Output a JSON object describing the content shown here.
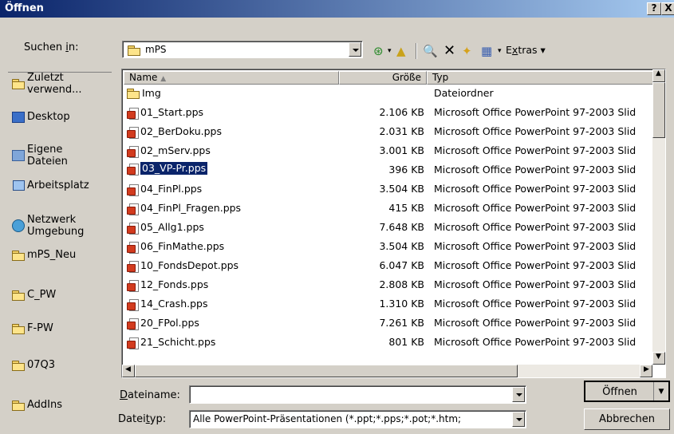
{
  "window": {
    "title": "Öffnen",
    "help": "?",
    "close": "X"
  },
  "lookin": {
    "label": "Suchen in:",
    "value": "mPS"
  },
  "toolbar": {
    "extras": "Extras"
  },
  "places": [
    {
      "label": "Zuletzt verwend...",
      "icon": "recent-folder-icon"
    },
    {
      "label": "Desktop",
      "icon": "desktop-icon"
    },
    {
      "label": "Eigene Dateien",
      "icon": "my-documents-icon"
    },
    {
      "label": "Arbeitsplatz",
      "icon": "my-computer-icon"
    },
    {
      "label": "Netzwerk Umgebung",
      "icon": "network-icon"
    },
    {
      "label": "mPS_Neu",
      "icon": "folder-icon"
    },
    {
      "label": "C_PW",
      "icon": "folder-icon"
    },
    {
      "label": "F-PW",
      "icon": "folder-icon"
    },
    {
      "label": "07Q3",
      "icon": "folder-icon"
    },
    {
      "label": "AddIns",
      "icon": "folder-icon"
    }
  ],
  "columns": {
    "name": "Name",
    "size": "Größe",
    "type": "Typ"
  },
  "files": [
    {
      "name": "Img",
      "size": "",
      "type": "Dateiordner",
      "folder": true
    },
    {
      "name": "01_Start.pps",
      "size": "2.106 KB",
      "type": "Microsoft Office PowerPoint 97-2003 Slid"
    },
    {
      "name": "02_BerDoku.pps",
      "size": "2.031 KB",
      "type": "Microsoft Office PowerPoint 97-2003 Slid"
    },
    {
      "name": "02_mServ.pps",
      "size": "3.001 KB",
      "type": "Microsoft Office PowerPoint 97-2003 Slid"
    },
    {
      "name": "03_VP-Pr.pps",
      "size": "396 KB",
      "type": "Microsoft Office PowerPoint 97-2003 Slid",
      "selected": true
    },
    {
      "name": "04_FinPl.pps",
      "size": "3.504 KB",
      "type": "Microsoft Office PowerPoint 97-2003 Slid"
    },
    {
      "name": "04_FinPl_Fragen.pps",
      "size": "415 KB",
      "type": "Microsoft Office PowerPoint 97-2003 Slid"
    },
    {
      "name": "05_Allg1.pps",
      "size": "7.648 KB",
      "type": "Microsoft Office PowerPoint 97-2003 Slid"
    },
    {
      "name": "06_FinMathe.pps",
      "size": "3.504 KB",
      "type": "Microsoft Office PowerPoint 97-2003 Slid"
    },
    {
      "name": "10_FondsDepot.pps",
      "size": "6.047 KB",
      "type": "Microsoft Office PowerPoint 97-2003 Slid"
    },
    {
      "name": "12_Fonds.pps",
      "size": "2.808 KB",
      "type": "Microsoft Office PowerPoint 97-2003 Slid"
    },
    {
      "name": "14_Crash.pps",
      "size": "1.310 KB",
      "type": "Microsoft Office PowerPoint 97-2003 Slid"
    },
    {
      "name": "20_FPol.pps",
      "size": "7.261 KB",
      "type": "Microsoft Office PowerPoint 97-2003 Slid"
    },
    {
      "name": "21_Schicht.pps",
      "size": "801 KB",
      "type": "Microsoft Office PowerPoint 97-2003 Slid"
    }
  ],
  "filename": {
    "label": "Dateiname:",
    "value": ""
  },
  "filetype": {
    "label": "Dateityp:",
    "value": "Alle PowerPoint-Präsentationen (*.ppt;*.pps;*.pot;*.htm;"
  },
  "buttons": {
    "open": "Öffnen",
    "cancel": "Abbrechen"
  }
}
